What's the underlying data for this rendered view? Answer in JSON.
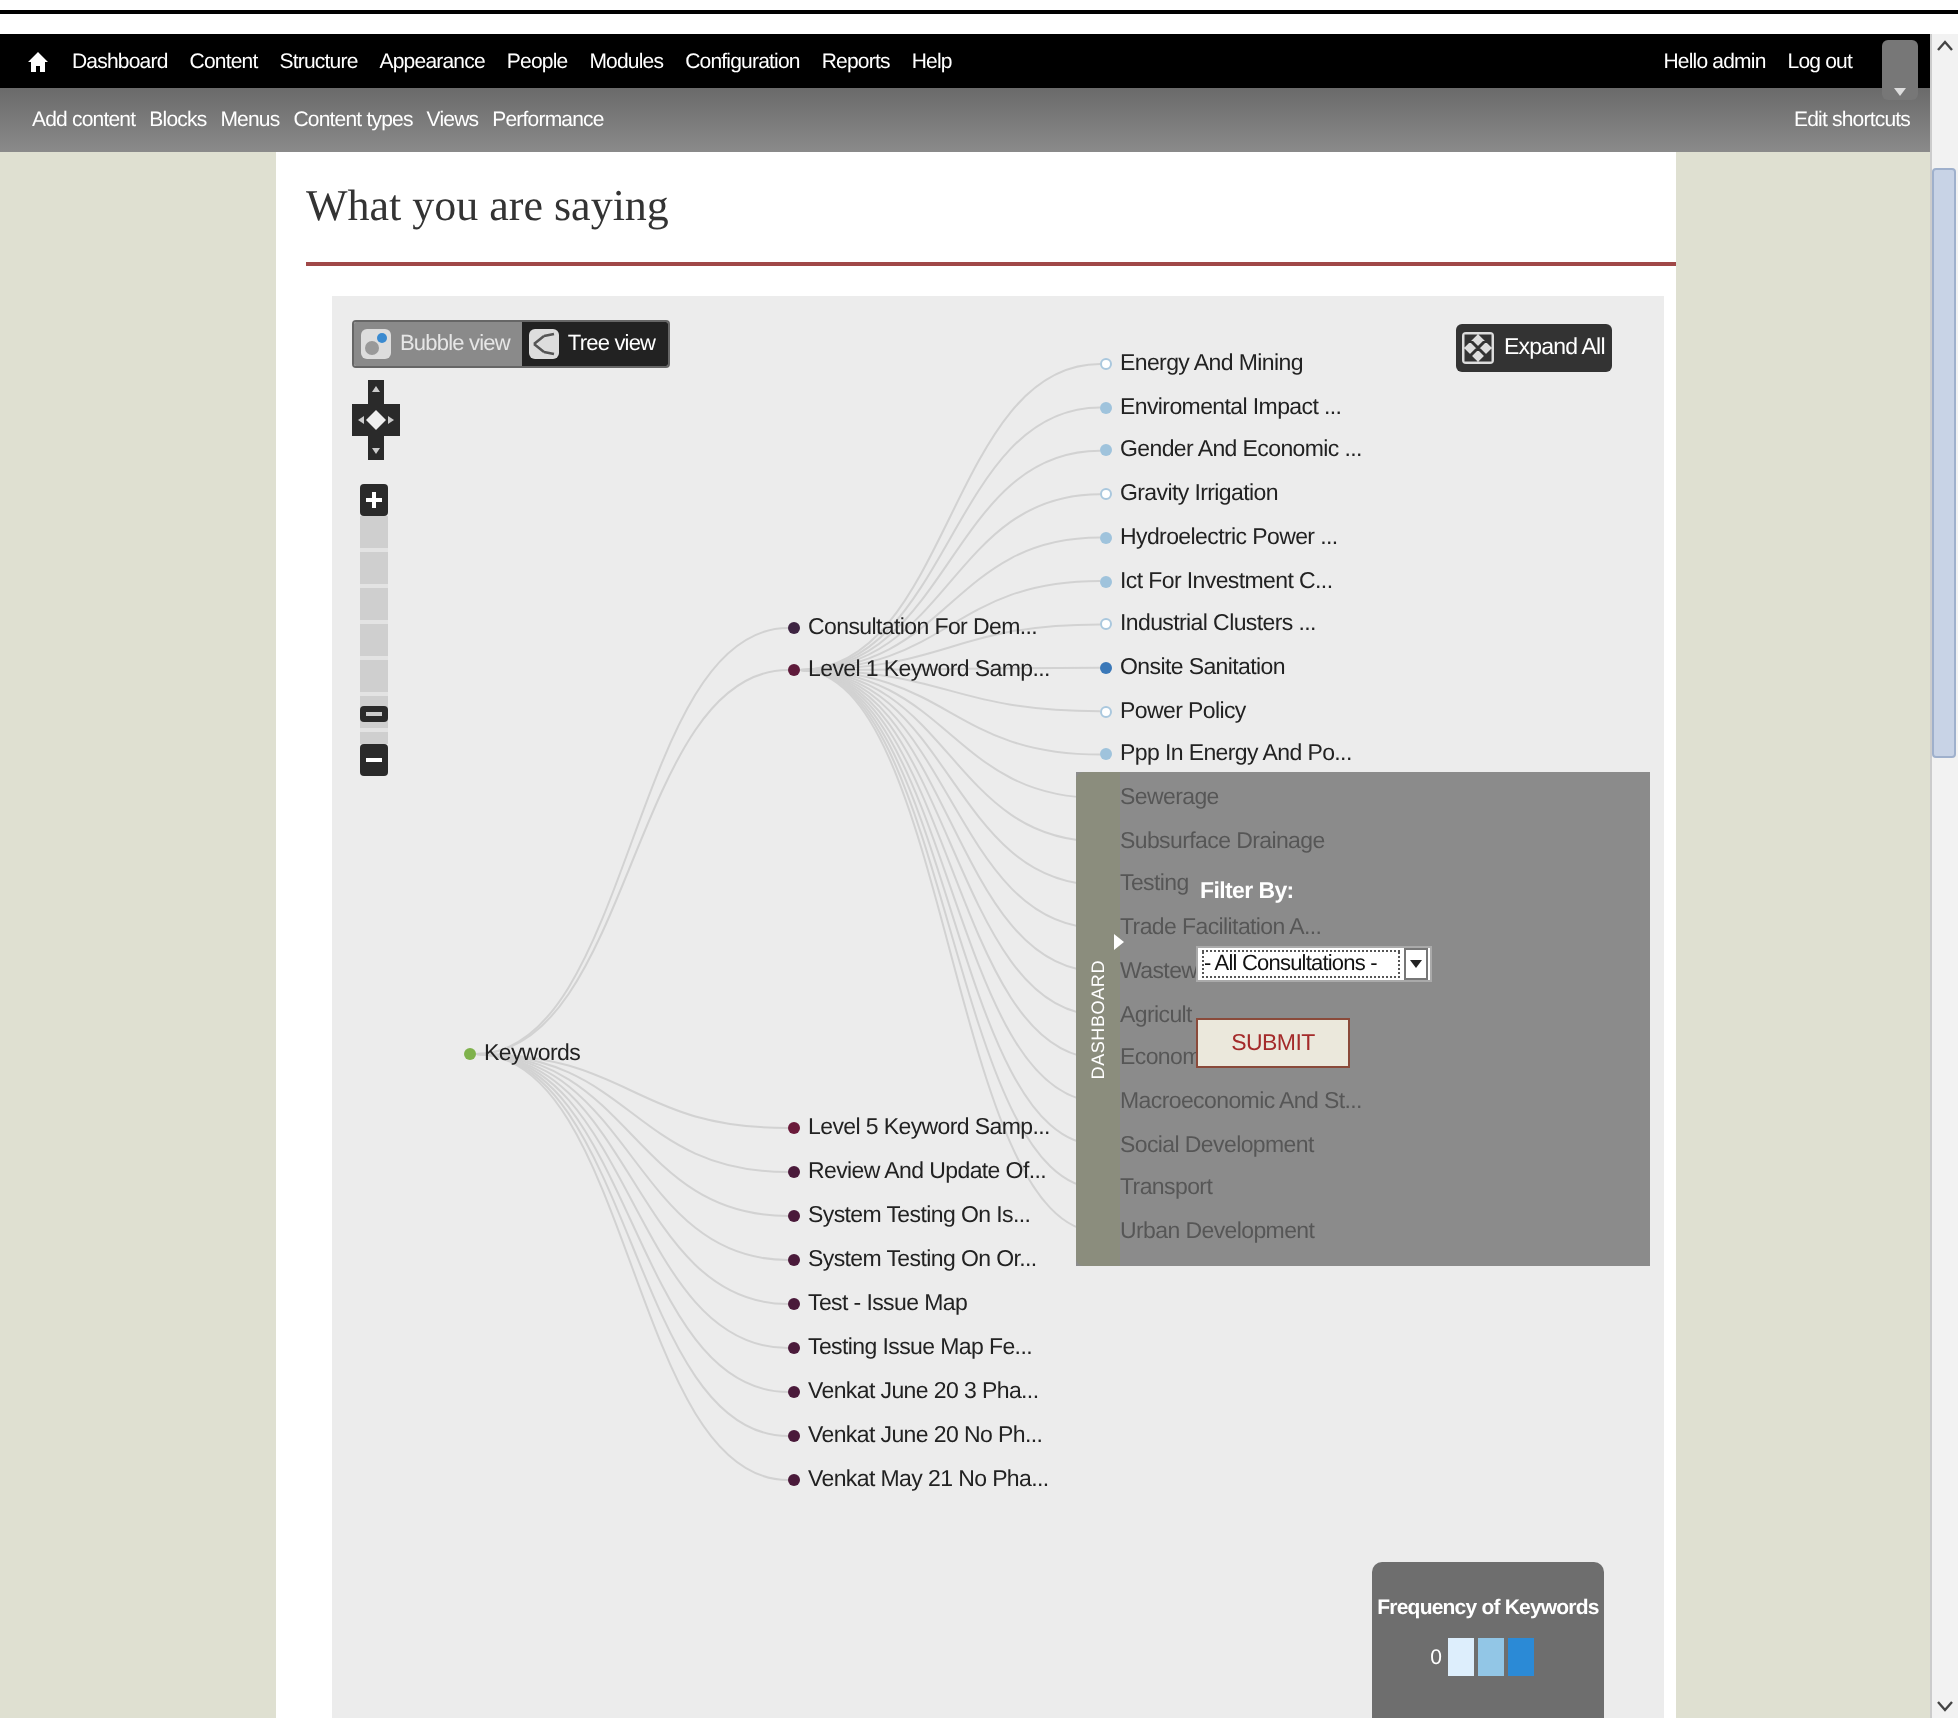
{
  "toolbar": {
    "menu": [
      "Dashboard",
      "Content",
      "Structure",
      "Appearance",
      "People",
      "Modules",
      "Configuration",
      "Reports",
      "Help"
    ],
    "user_greeting": "Hello admin",
    "logout": "Log out"
  },
  "shortcuts": {
    "items": [
      "Add content",
      "Blocks",
      "Menus",
      "Content types",
      "Views",
      "Performance"
    ],
    "edit": "Edit shortcuts"
  },
  "page_title": "What you are saying",
  "view_toggle": [
    {
      "label": "Bubble view",
      "selected": false
    },
    {
      "label": "Tree view",
      "selected": true
    }
  ],
  "zoom": {
    "level": 0.1
  },
  "expand_all": "Expand All",
  "tree": {
    "label": "Keywords",
    "color": "#7fb24c",
    "children": [
      {
        "label": "Consultation For Dem...",
        "color": "#3e2442"
      },
      {
        "label": "Level 1 Keyword Samp...",
        "color": "#5e1a3a",
        "children": [
          {
            "label": "Energy And Mining",
            "color": "#ffffff"
          },
          {
            "label": "Enviromental Impact ...",
            "color": "#9fc3dc"
          },
          {
            "label": "Gender And Economic ...",
            "color": "#9fc3dc"
          },
          {
            "label": "Gravity Irrigation",
            "color": "#ffffff"
          },
          {
            "label": "Hydroelectric Power ...",
            "color": "#9fc3dc"
          },
          {
            "label": "Ict For Investment C...",
            "color": "#9fc3dc"
          },
          {
            "label": "Industrial Clusters ...",
            "color": "#ffffff"
          },
          {
            "label": "Onsite Sanitation",
            "color": "#3a78b8"
          },
          {
            "label": "Power Policy",
            "color": "#ffffff"
          },
          {
            "label": "Ppp In Energy And Po...",
            "color": "#9fc3dc"
          },
          {
            "label": "Sewerage"
          },
          {
            "label": "Subsurface Drainage"
          },
          {
            "label": "Testing"
          },
          {
            "label": "Trade Facilitation A..."
          },
          {
            "label": "Wastew"
          },
          {
            "label": "Agricult"
          },
          {
            "label": "Econom"
          },
          {
            "label": "Macroeconomic And St..."
          },
          {
            "label": "Social Development"
          },
          {
            "label": "Transport"
          },
          {
            "label": "Urban Development"
          }
        ]
      },
      {
        "label": "Level 5 Keyword Samp...",
        "color": "#6a1a3a"
      },
      {
        "label": "Review And Update Of...",
        "color": "#4a1a3a"
      },
      {
        "label": "System Testing On Is...",
        "color": "#4a1a3a"
      },
      {
        "label": "System Testing On Or...",
        "color": "#4a1a3a"
      },
      {
        "label": "Test - Issue Map",
        "color": "#4a1a3a"
      },
      {
        "label": "Testing Issue Map Fe...",
        "color": "#4a1a3a"
      },
      {
        "label": "Venkat June 20 3 Pha...",
        "color": "#4a1a3a"
      },
      {
        "label": "Venkat June 20 No Ph...",
        "color": "#4a1a3a"
      },
      {
        "label": "Venkat May 21 No Pha...",
        "color": "#4a1a3a"
      }
    ]
  },
  "dashboard": {
    "tab": "DASHBOARD",
    "filter_label": "Filter By:",
    "select_value": "- All Consultations -",
    "submit": "SUBMIT"
  },
  "legend": {
    "title": "Frequency of Keywords",
    "min": "0",
    "swatches": [
      {
        "color": "#ddeefc"
      },
      {
        "color": "#92c6e6"
      },
      {
        "color": "#2b8ad6"
      }
    ]
  }
}
